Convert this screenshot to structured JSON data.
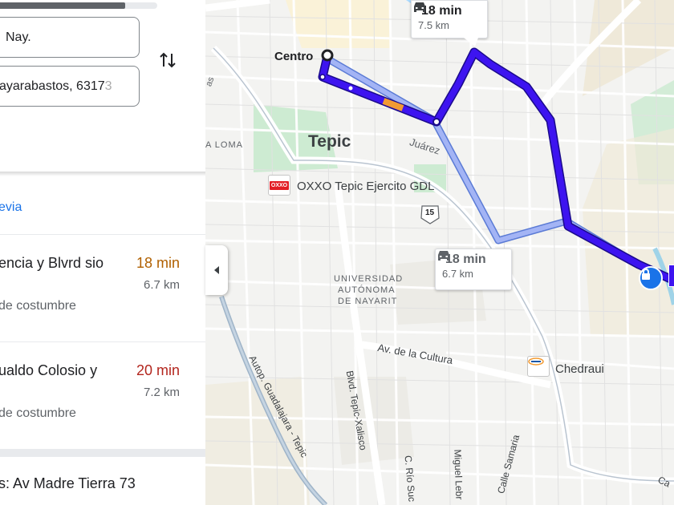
{
  "panel": {
    "origin_value": "Nay.",
    "destination_value_main": "ayarabastos, 6317",
    "destination_value_fade": "3",
    "preview_link": "evia",
    "routes": [
      {
        "name": "encia y Blvrd sio",
        "time": "18 min",
        "distance": "6.7 km",
        "note": "de costumbre"
      },
      {
        "name": "ualdo Colosio y",
        "time": "20 min",
        "distance": "7.2 km",
        "note": "de costumbre"
      }
    ],
    "destination_line": "s: Av Madre Tierra 73"
  },
  "map": {
    "labels": {
      "centro": "Centro",
      "tepic": "Tepic",
      "la_loma": "A LOMA",
      "juarez": "Juárez",
      "oxxo": "OXXO Tepic Ejercito GDL",
      "highway": "15",
      "university_1": "UNIVERSIDAD",
      "university_2": "AUTÓNOMA",
      "university_3": "DE NAYARIT",
      "av_cultura": "Av. de la Cultura",
      "chedraui": "Chedraui",
      "autop": "Autop. Guadalajara - Tepic",
      "blvd": "Blvd. Tepic-Xalisco",
      "rio": "C. Río Suc",
      "miguel": "Miguel Lebr",
      "samaria": "Calle Samaria",
      "ca": "Ca",
      "las": "as",
      "poi_oxxo_text": "OXXO"
    },
    "callouts": {
      "primary": {
        "time": "18 min",
        "distance": "7.5 km"
      },
      "alternate": {
        "time": "18 min",
        "distance": "6.7 km"
      }
    },
    "colors": {
      "primary_route": "#3d14f0",
      "alternate_route": "#a3b4f5",
      "traffic": "#f29a33"
    }
  }
}
